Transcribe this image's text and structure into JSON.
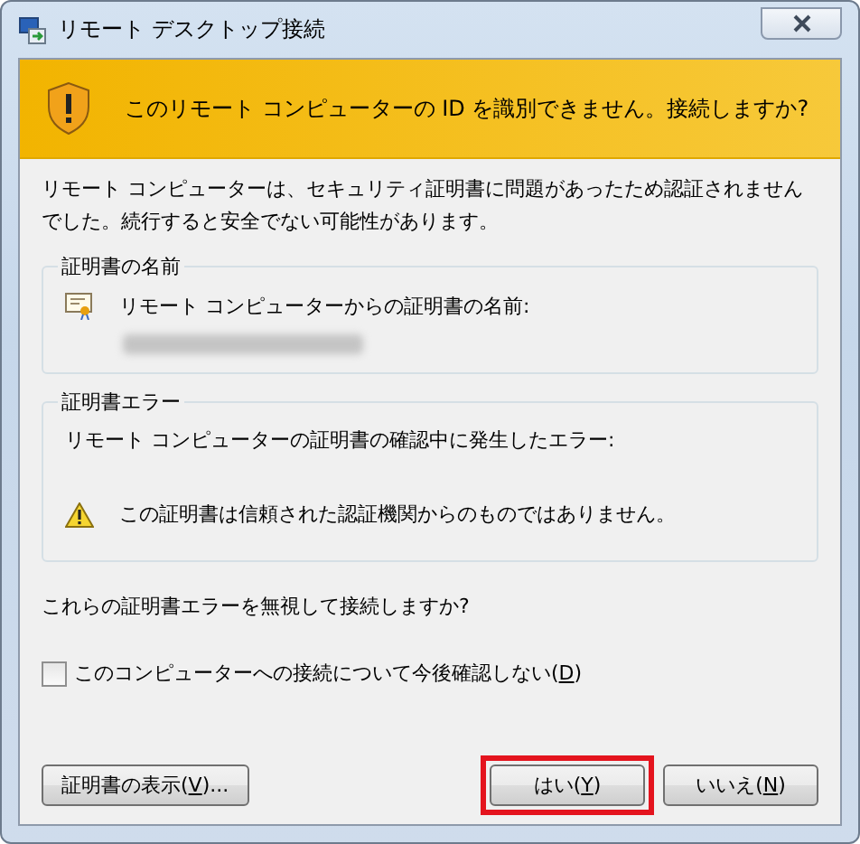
{
  "window": {
    "title": "リモート デスクトップ接続"
  },
  "banner": {
    "text": "このリモート コンピューターの ID を識別できません。接続しますか?"
  },
  "intro": "リモート コンピューターは、セキュリティ証明書に問題があったため認証されませんでした。続行すると安全でない可能性があります。",
  "certificate_name": {
    "title": "証明書の名前",
    "label": "リモート コンピューターからの証明書の名前:",
    "value_redacted": true
  },
  "certificate_errors": {
    "title": "証明書エラー",
    "label": "リモート コンピューターの証明書の確認中に発生したエラー:",
    "errors": [
      "この証明書は信頼された認証機関からのものではありません。"
    ]
  },
  "question": "これらの証明書エラーを無視して接続しますか?",
  "dont_ask": {
    "before": "このコンピューターへの接続について今後確認しない(",
    "key": "D",
    "after": ")",
    "checked": false
  },
  "buttons": [
    {
      "kind": "left",
      "before": "証明書の表示(",
      "key": "V",
      "after": ")...",
      "highlighted": false
    },
    {
      "kind": "right",
      "before": "はい(",
      "key": "Y",
      "after": ")",
      "highlighted": true
    },
    {
      "kind": "right",
      "before": "いいえ(",
      "key": "N",
      "after": ")",
      "highlighted": false
    }
  ]
}
